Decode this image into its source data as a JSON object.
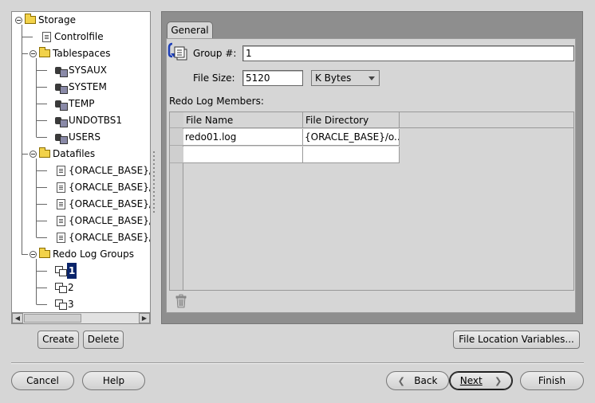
{
  "tree": {
    "root_label": "Storage",
    "controlfile_label": "Controlfile",
    "tablespaces_label": "Tablespaces",
    "tablespaces": [
      "SYSAUX",
      "SYSTEM",
      "TEMP",
      "UNDOTBS1",
      "USERS"
    ],
    "datafiles_label": "Datafiles",
    "datafiles": [
      "{ORACLE_BASE}/o",
      "{ORACLE_BASE}/o",
      "{ORACLE_BASE}/o",
      "{ORACLE_BASE}/o",
      "{ORACLE_BASE}/o"
    ],
    "redo_groups_label": "Redo Log Groups",
    "redo_groups": [
      "1",
      "2",
      "3"
    ],
    "selected_group": "1"
  },
  "left_buttons": {
    "create": "Create",
    "delete": "Delete"
  },
  "tab": {
    "label": "General"
  },
  "form": {
    "group_label": "Group #:",
    "group_value": "1",
    "file_size_label": "File Size:",
    "file_size_value": "5120",
    "unit_selected": "K Bytes",
    "members_label": "Redo Log Members:"
  },
  "members_table": {
    "columns": [
      "File Name",
      "File Directory"
    ],
    "rows": [
      [
        "redo01.log",
        "{ORACLE_BASE}/o..."
      ],
      [
        "",
        ""
      ]
    ]
  },
  "file_location_button": "File Location Variables...",
  "footer": {
    "cancel": "Cancel",
    "help": "Help",
    "back_chev": "❮",
    "back": "Back",
    "next": "Next",
    "next_chev": "❯",
    "finish": "Finish"
  },
  "colors": {
    "selection": "#0a246a",
    "panel_dark": "#8e8e8e"
  }
}
